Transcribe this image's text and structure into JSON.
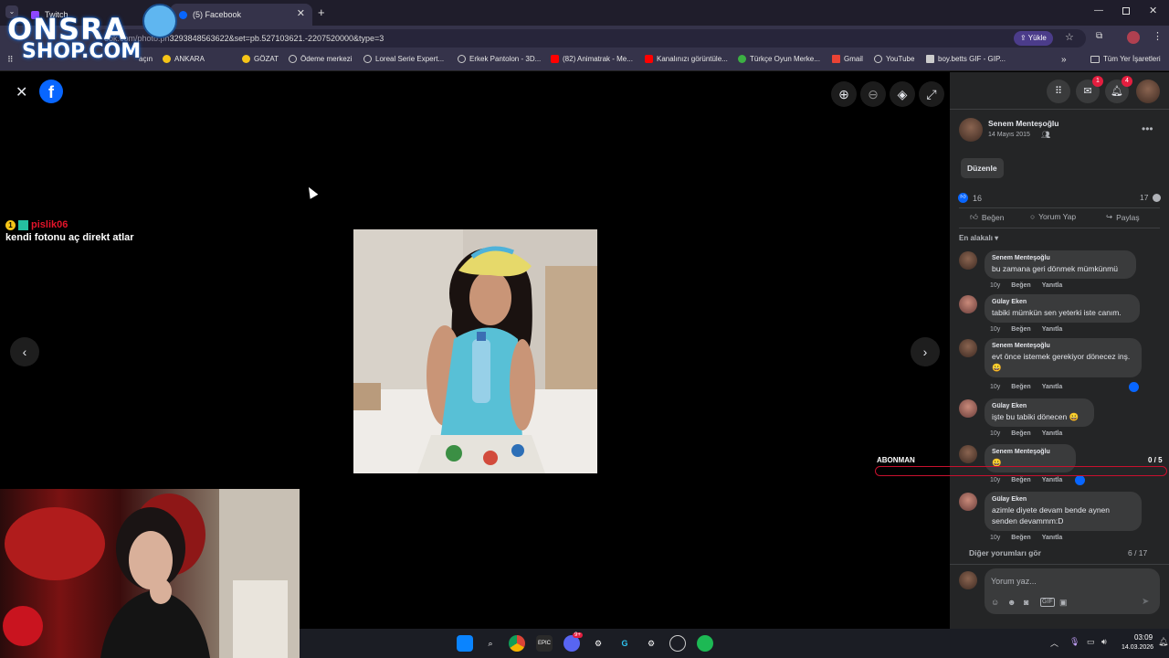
{
  "browser": {
    "tabs": [
      {
        "title": "Twitch",
        "active": false
      },
      {
        "title": "(5) Facebook",
        "active": true
      }
    ],
    "url": "facebook.com/photo.php?fbid=3293848563622&set=pb.527103621.-2207520000&type=3",
    "url_visible": "ook.com/photo.ph",
    "url_tail": "3293848563622&set=pb.527103621.-2207520000&type=3",
    "upload_button": "Yükle",
    "bookmarks": [
      {
        "label": "açın",
        "icon": "page-icon"
      },
      {
        "label": "ANKARA",
        "icon": "smile-icon"
      },
      {
        "label": "GÖZAT",
        "icon": "smile-icon"
      },
      {
        "label": "Ödeme merkezi",
        "icon": "globe-icon"
      },
      {
        "label": "Loreal Serie Expert...",
        "icon": "globe-icon"
      },
      {
        "label": "Erkek Pantolon - 3D...",
        "icon": "globe-icon"
      },
      {
        "label": "(82) Animatrak - Me...",
        "icon": "youtube-icon"
      },
      {
        "label": "Kanalınızı görüntüle...",
        "icon": "youtube-icon"
      },
      {
        "label": "Türkçe Oyun Merke...",
        "icon": "game-icon"
      },
      {
        "label": "Gmail",
        "icon": "gmail-icon"
      },
      {
        "label": "YouTube",
        "icon": "globe-icon"
      },
      {
        "label": "boy.betts GIF - GIP...",
        "icon": "page-icon"
      }
    ],
    "all_bookmarks": "Tüm Yer İşaretleri"
  },
  "overlay": {
    "logo_line1": "ONSRA",
    "logo_line2": "SHOP.COM",
    "chat_user": "pislik06",
    "chat_badge": "1",
    "chat_text": "kendi fotonu aç direkt atlar",
    "subs_label": "ABONMAN",
    "subs_count": "0 / 5",
    "subs_progress": 0
  },
  "header": {
    "messenger_badge": "1",
    "notifications_badge": "4"
  },
  "post": {
    "author": "Senem Menteşoğlu",
    "date": "14 Mayıs 2015",
    "edit_button": "Düzenle",
    "reactions_count": "16",
    "comments_count": "17",
    "like_label": "Beğen",
    "comment_label": "Yorum Yap",
    "share_label": "Paylaş",
    "sort_label": "En alakalı"
  },
  "comments": [
    {
      "name": "Senem Menteşoğlu",
      "text": "bu zamana geri dönmek mümkünmü",
      "time": "10y",
      "like": "Beğen",
      "reply": "Yanıtla"
    },
    {
      "name": "Gülay Eken",
      "text": "tabiki mümkün sen yeterki iste canım.",
      "time": "10y",
      "like": "Beğen",
      "reply": "Yanıtla"
    },
    {
      "name": "Senem Menteşoğlu",
      "text": "evt önce istemek gerekiyor dönecez inş.😀",
      "time": "10y",
      "like": "Beğen",
      "reply": "Yanıtla"
    },
    {
      "name": "Gülay Eken",
      "text": "işte bu tabiki dönecen 😀",
      "time": "10y",
      "like": "Beğen",
      "reply": "Yanıtla"
    },
    {
      "name": "Senem Menteşoğlu",
      "text": "😀",
      "time": "10y",
      "like": "Beğen",
      "reply": "Yanıtla"
    },
    {
      "name": "Gülay Eken",
      "text": "azimle diyete devam bende aynen senden devammm:D",
      "time": "10y",
      "like": "Beğen",
      "reply": "Yanıtla"
    }
  ],
  "more_comments": "Diğer yorumları gör",
  "comment_pager": "6 / 17",
  "comment_placeholder": "Yorum yaz...",
  "taskbar": {
    "time": "03:09",
    "date": "14.03.2026",
    "discord_badge": "9+"
  },
  "colors": {
    "fb_blue": "#0866ff",
    "sidebar_bg": "#242526",
    "bubble_bg": "#3a3b3c",
    "badge_red": "#e41e3f",
    "subs_bar": "#c8102e"
  }
}
